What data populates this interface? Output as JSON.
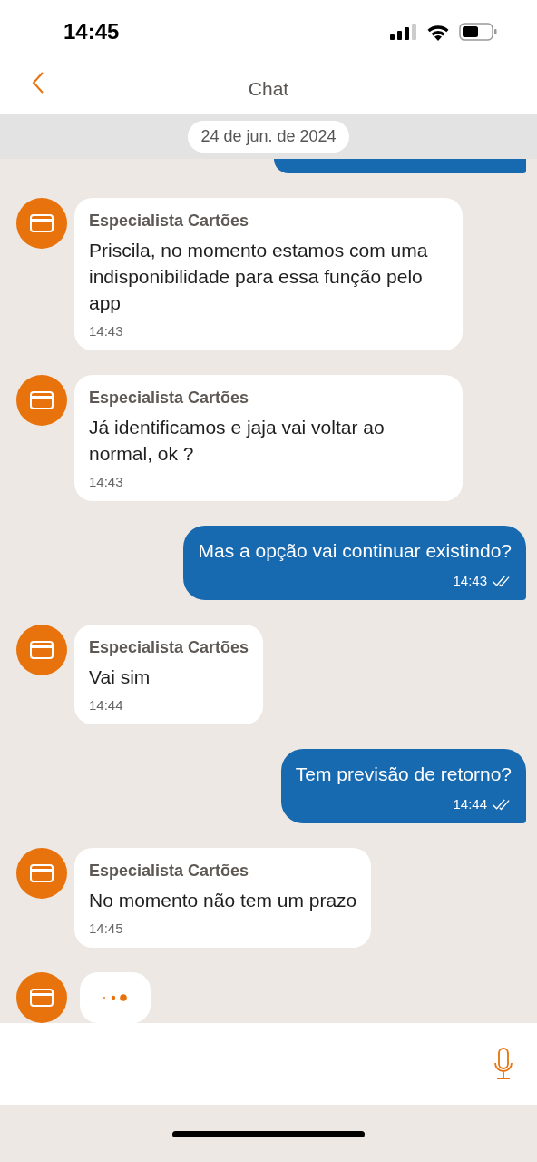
{
  "status_bar": {
    "time": "14:45"
  },
  "header": {
    "title": "Chat"
  },
  "date_chip": "24 de jun. de 2024",
  "messages": [
    {
      "kind": "clipped"
    },
    {
      "kind": "agent",
      "sender": "Especialista Cartões",
      "text": "Priscila, no momento estamos com uma indisponibilidade para essa função pelo app",
      "time": "14:43"
    },
    {
      "kind": "agent",
      "sender": "Especialista Cartões",
      "text": "Já identificamos e jaja vai voltar ao normal, ok ?",
      "time": "14:43"
    },
    {
      "kind": "user",
      "text": "Mas a opção vai continuar existindo?",
      "time": "14:43",
      "read": true
    },
    {
      "kind": "agent",
      "sender": "Especialista Cartões",
      "text": "Vai sim",
      "time": "14:44"
    },
    {
      "kind": "user",
      "text": "Tem previsão de retorno?",
      "time": "14:44",
      "read": true
    },
    {
      "kind": "agent",
      "sender": "Especialista Cartões",
      "text": "No momento não tem um prazo",
      "time": "14:45"
    },
    {
      "kind": "typing"
    }
  ]
}
